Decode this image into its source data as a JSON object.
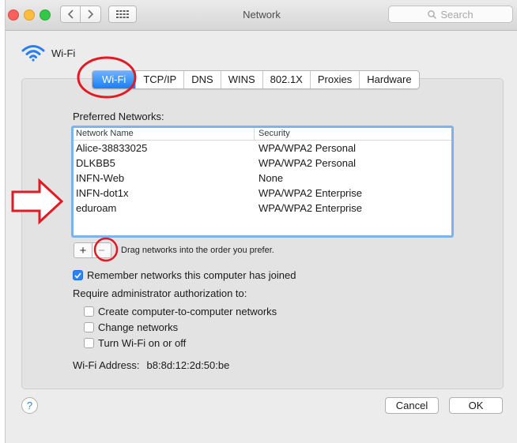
{
  "window": {
    "title": "Network",
    "search_placeholder": "Search"
  },
  "header": {
    "interface_name": "Wi-Fi"
  },
  "tabs": [
    {
      "label": "Wi-Fi",
      "active": true
    },
    {
      "label": "TCP/IP",
      "active": false
    },
    {
      "label": "DNS",
      "active": false
    },
    {
      "label": "WINS",
      "active": false
    },
    {
      "label": "802.1X",
      "active": false
    },
    {
      "label": "Proxies",
      "active": false
    },
    {
      "label": "Hardware",
      "active": false
    }
  ],
  "preferred": {
    "label": "Preferred Networks:",
    "columns": [
      "Network Name",
      "Security"
    ],
    "rows": [
      {
        "name": "Alice-38833025",
        "security": "WPA/WPA2 Personal"
      },
      {
        "name": "DLKBB5",
        "security": "WPA/WPA2 Personal"
      },
      {
        "name": "INFN-Web",
        "security": "None"
      },
      {
        "name": "INFN-dot1x",
        "security": "WPA/WPA2 Enterprise"
      },
      {
        "name": "eduroam",
        "security": "WPA/WPA2 Enterprise"
      }
    ],
    "add_label": "+",
    "remove_label": "−",
    "drag_hint": "Drag networks into the order you prefer."
  },
  "options": {
    "remember_label": "Remember networks this computer has joined",
    "remember_checked": true,
    "require_admin_label": "Require administrator authorization to:",
    "create_label": "Create computer-to-computer networks",
    "change_label": "Change networks",
    "toggle_label": "Turn Wi-Fi on or off"
  },
  "address": {
    "label": "Wi-Fi Address:",
    "value": "b8:8d:12:2d:50:be"
  },
  "footer": {
    "help_label": "?",
    "cancel_label": "Cancel",
    "ok_label": "OK"
  },
  "colors": {
    "accent": "#1a7ef5",
    "annotation": "#e01b24"
  },
  "icons": [
    "wifi-icon",
    "search-icon",
    "grid-icon",
    "chevron-left-icon",
    "chevron-right-icon",
    "checkmark-icon",
    "help-icon"
  ]
}
